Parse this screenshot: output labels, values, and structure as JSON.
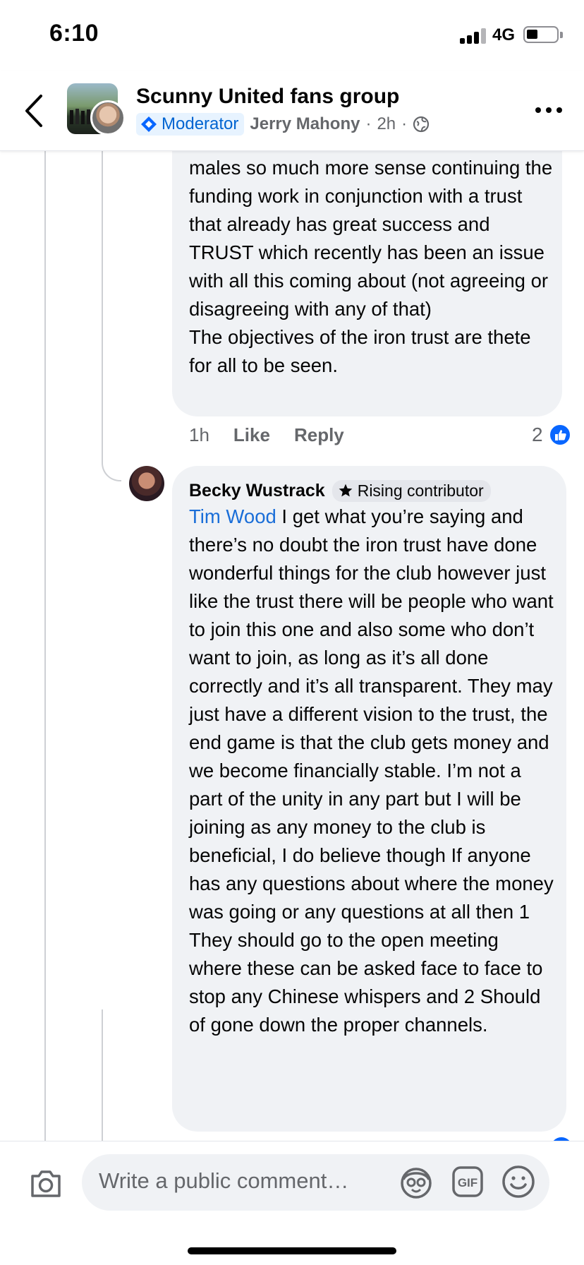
{
  "status_bar": {
    "time": "6:10",
    "network": "4G"
  },
  "header": {
    "group_name": "Scunny United fans group",
    "moderator_label": "Moderator",
    "author": "Jerry Mahony",
    "time_ago": "2h",
    "separator": "·",
    "icons": [
      "back-chevron-icon",
      "globe-icon",
      "more-icon"
    ]
  },
  "comments": [
    {
      "text": "males so much more sense continuing the funding work in conjunction with a trust that already has great success and TRUST which recently has been an issue with all this coming about (not agreeing or disagreeing with any of that)\nThe objectives of the iron trust are thete for all to be seen.",
      "time": "1h",
      "like_label": "Like",
      "reply_label": "Reply",
      "reaction_count": "2"
    },
    {
      "author": "Becky Wustrack",
      "badge": "Rising contributor",
      "mention": "Tim Wood",
      "text": " I get what you’re saying and there’s no doubt the iron trust have done wonderful things for the club however just like the trust there will be people who want to join this one and also some who don’t want to join, as long as it’s all done correctly and it’s all transparent. They may just have a different vision to the trust, the end game is that the club gets money and we become financially stable. I’m not a part of the unity in any part but I will be joining as any money to the club is beneficial, I do believe though If anyone has any questions about where the money was going or any questions at all then 1 They should go to the open meeting where these can be asked face to face to stop any Chinese whispers and 2 Should of gone down the proper channels."
    }
  ],
  "composer": {
    "placeholder": "Write a public comment…",
    "icons": [
      "camera-icon",
      "avatar-sticker-icon",
      "gif-icon",
      "emoji-icon"
    ]
  },
  "colors": {
    "accent": "#0866ff",
    "mention": "#1a6ed8",
    "bubble": "#f0f2f5",
    "secondary_text": "#65676b"
  }
}
